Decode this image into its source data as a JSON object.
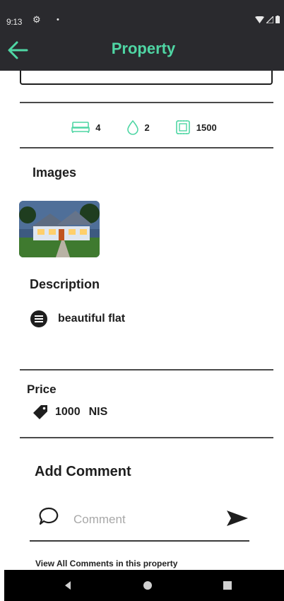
{
  "status": {
    "time": "9:13"
  },
  "app_bar": {
    "title": "Property"
  },
  "features": {
    "bedrooms": "4",
    "bathrooms": "2",
    "area": "1500"
  },
  "images": {
    "title": "Images"
  },
  "description": {
    "title": "Description",
    "text": "beautiful flat"
  },
  "price": {
    "label": "Price",
    "value": "1000",
    "currency": "NIS"
  },
  "comments": {
    "title": "Add Comment",
    "placeholder": "Comment",
    "view_all": "View All Comments in this property"
  },
  "colors": {
    "accent": "#4fd6a4",
    "bar": "#2a2a2e"
  },
  "icons": [
    "back-arrow-icon",
    "bed-icon",
    "drop-icon",
    "area-icon",
    "list-icon",
    "tag-icon",
    "comment-icon",
    "send-icon"
  ]
}
